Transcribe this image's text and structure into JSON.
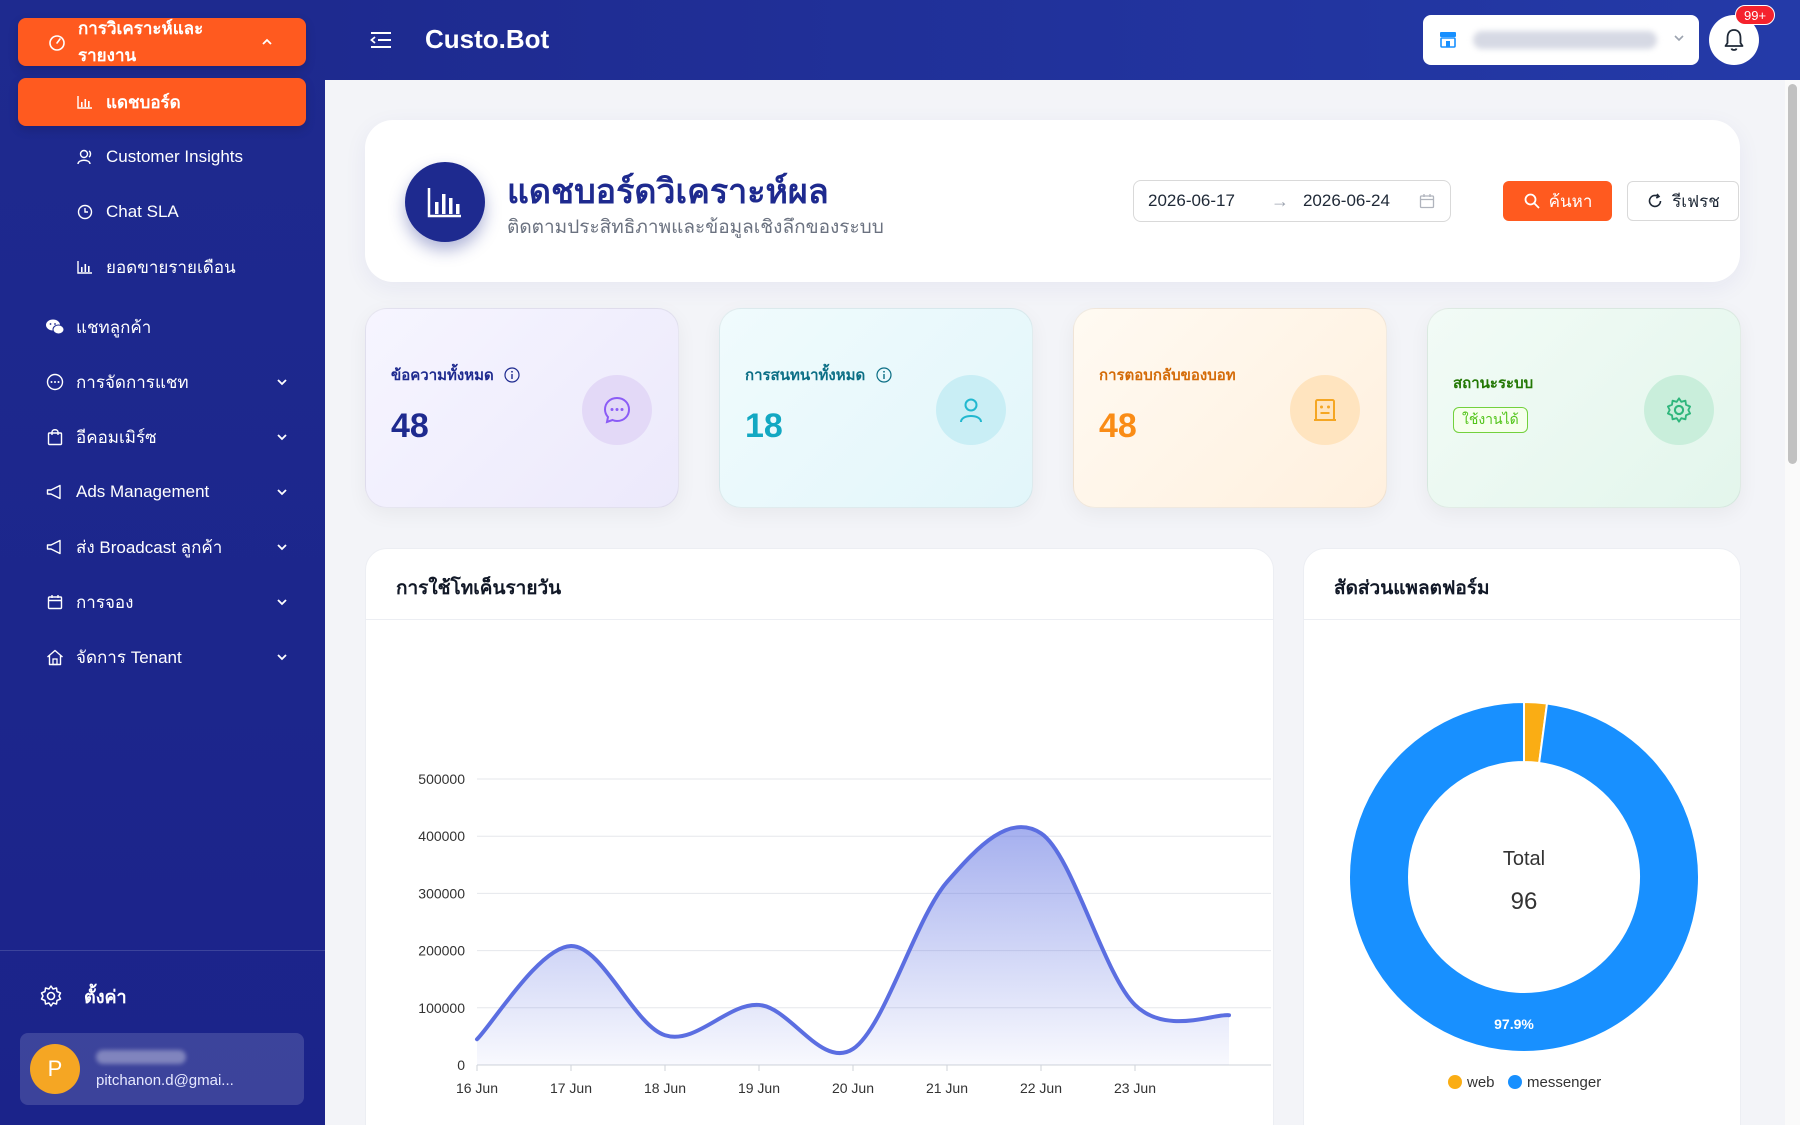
{
  "sidebar": {
    "group_label": "การวิเคราะห์และรายงาน",
    "sub_items": [
      {
        "label": "แดชบอร์ด",
        "icon": "bar-chart-icon",
        "active": true
      },
      {
        "label": "Customer Insights",
        "icon": "users-icon"
      },
      {
        "label": "Chat SLA",
        "icon": "clock-icon"
      },
      {
        "label": "ยอดขายรายเดือน",
        "icon": "bar-chart-icon"
      }
    ],
    "items": [
      {
        "label": "แชทลูกค้า",
        "icon": "wechat-icon",
        "has_chevron": false
      },
      {
        "label": "การจัดการแชท",
        "icon": "message-icon",
        "has_chevron": true
      },
      {
        "label": "อีคอมเมิร์ซ",
        "icon": "shopping-bag-icon",
        "has_chevron": true
      },
      {
        "label": "Ads Management",
        "icon": "megaphone-icon",
        "has_chevron": true
      },
      {
        "label": "ส่ง Broadcast ลูกค้า",
        "icon": "megaphone-icon",
        "has_chevron": true
      },
      {
        "label": "การจอง",
        "icon": "calendar-icon",
        "has_chevron": true
      },
      {
        "label": "จัดการ Tenant",
        "icon": "home-icon",
        "has_chevron": true
      }
    ],
    "settings_label": "ตั้งค่า",
    "user": {
      "avatar_letter": "P",
      "email": "pitchanon.d@gmai..."
    }
  },
  "topbar": {
    "brand": "Custo.Bot",
    "notification_badge": "99+"
  },
  "header": {
    "title": "แดชบอร์ดวิเคราะห์ผล",
    "subtitle": "ติดตามประสิทธิภาพและข้อมูลเชิงลึกของระบบ",
    "date_start": "2026-06-17",
    "date_end": "2026-06-24",
    "search_label": "ค้นหา",
    "refresh_label": "รีเฟรช"
  },
  "stats": [
    {
      "label": "ข้อความทั้งหมด",
      "value": "48",
      "icon": "chat-bubble-icon",
      "color": "#1e2a8f",
      "has_info": true
    },
    {
      "label": "การสนทนาทั้งหมด",
      "value": "18",
      "icon": "user-icon",
      "color": "#13a8c2",
      "has_info": true
    },
    {
      "label": "การตอบกลับของบอท",
      "value": "48",
      "icon": "robot-icon",
      "color": "#fa8c16",
      "has_info": false
    },
    {
      "label": "สถานะระบบ",
      "status": "ใช้งานได้",
      "icon": "gear-icon",
      "color": "#237804"
    }
  ],
  "colors": {
    "accent": "#ff5a1f",
    "brand": "#1e2a8f",
    "line": "#5b6ee1",
    "web": "#faad14",
    "messenger": "#1890ff"
  },
  "token_chart": {
    "title": "การใช้โทเค็นรายวัน"
  },
  "platform_chart": {
    "title": "สัดส่วนแพลตฟอร์ม",
    "center_label": "Total",
    "center_value": "96",
    "slice_label": "97.9%"
  },
  "chart_data": [
    {
      "type": "area",
      "title": "การใช้โทเค็นรายวัน",
      "x": [
        "16 Jun",
        "17 Jun",
        "18 Jun",
        "19 Jun",
        "20 Jun",
        "21 Jun",
        "22 Jun",
        "23 Jun"
      ],
      "x_ticks": [
        "16 Jun",
        "17 Jun",
        "18 Jun",
        "19 Jun",
        "20 Jun",
        "21 Jun",
        "22 Jun",
        "23 Jun"
      ],
      "points": [
        {
          "x": 0,
          "y": 45000
        },
        {
          "x": 1,
          "y": 208000
        },
        {
          "x": 2,
          "y": 52000
        },
        {
          "x": 3,
          "y": 105000
        },
        {
          "x": 4,
          "y": 28000
        },
        {
          "x": 5,
          "y": 320000
        },
        {
          "x": 6,
          "y": 405000
        },
        {
          "x": 7,
          "y": 105000
        },
        {
          "x": 8,
          "y": 87000
        }
      ],
      "y_ticks": [
        0,
        100000,
        200000,
        300000,
        400000,
        500000
      ],
      "ylim": [
        0,
        500000
      ],
      "grid": true
    },
    {
      "type": "pie",
      "title": "สัดส่วนแพลตฟอร์ม",
      "slices": [
        {
          "label": "web",
          "value": 2,
          "percent": 2.1
        },
        {
          "label": "messenger",
          "value": 94,
          "percent": 97.9
        }
      ],
      "total": 96,
      "legend": "bottom"
    }
  ]
}
